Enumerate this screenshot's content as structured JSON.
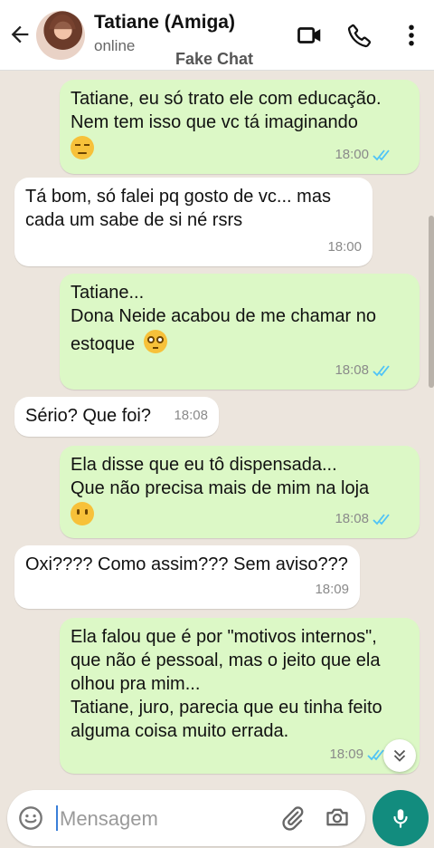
{
  "header": {
    "contact_name": "Tatiane (Amiga)",
    "status": "online",
    "watermark": "Fake Chat",
    "icons": [
      "back-arrow-icon",
      "avatar",
      "video-call-icon",
      "phone-icon",
      "more-menu-icon"
    ]
  },
  "messages": [
    {
      "direction": "out",
      "text": "Tatiane, eu só trato ele com educação.\nNem tem isso que vc tá imaginando",
      "emoji": "unamused-face",
      "time": "18:00",
      "read": true
    },
    {
      "direction": "in",
      "text": "Tá bom, só falei pq gosto de vc... mas\ncada um sabe de si né rsrs",
      "time": "18:00"
    },
    {
      "direction": "out",
      "text": "Tatiane...\nDona Neide acabou de me chamar no\nestoque",
      "emoji": "flushed-face",
      "time": "18:08",
      "read": true
    },
    {
      "direction": "in",
      "text": "Sério? Que foi?",
      "time": "18:08"
    },
    {
      "direction": "out",
      "text": "Ela disse que eu tô dispensada...\nQue não precisa mais de mim na loja",
      "emoji": "face-without-mouth",
      "time": "18:08",
      "read": true
    },
    {
      "direction": "in",
      "text": "Oxi???? Como assim??? Sem aviso???",
      "time": "18:09"
    },
    {
      "direction": "out",
      "text": "Ela falou que é por \"motivos internos\",\nque não é pessoal, mas o jeito que ela\nolhou pra mim...\nTatiane, juro, parecia que eu tinha feito\nalguma coisa muito errada.",
      "time": "18:09",
      "read": true
    }
  ],
  "composer": {
    "placeholder": "Mensagem",
    "icons": [
      "emoji-icon",
      "attach-icon",
      "camera-icon",
      "mic-icon"
    ]
  },
  "colors": {
    "header_bg": "#ffffff",
    "chat_bg": "#ece5dd",
    "outgoing_bubble": "#dcf8c6",
    "incoming_bubble": "#ffffff",
    "read_ticks": "#4fc3f7",
    "accent": "#128c7e"
  }
}
